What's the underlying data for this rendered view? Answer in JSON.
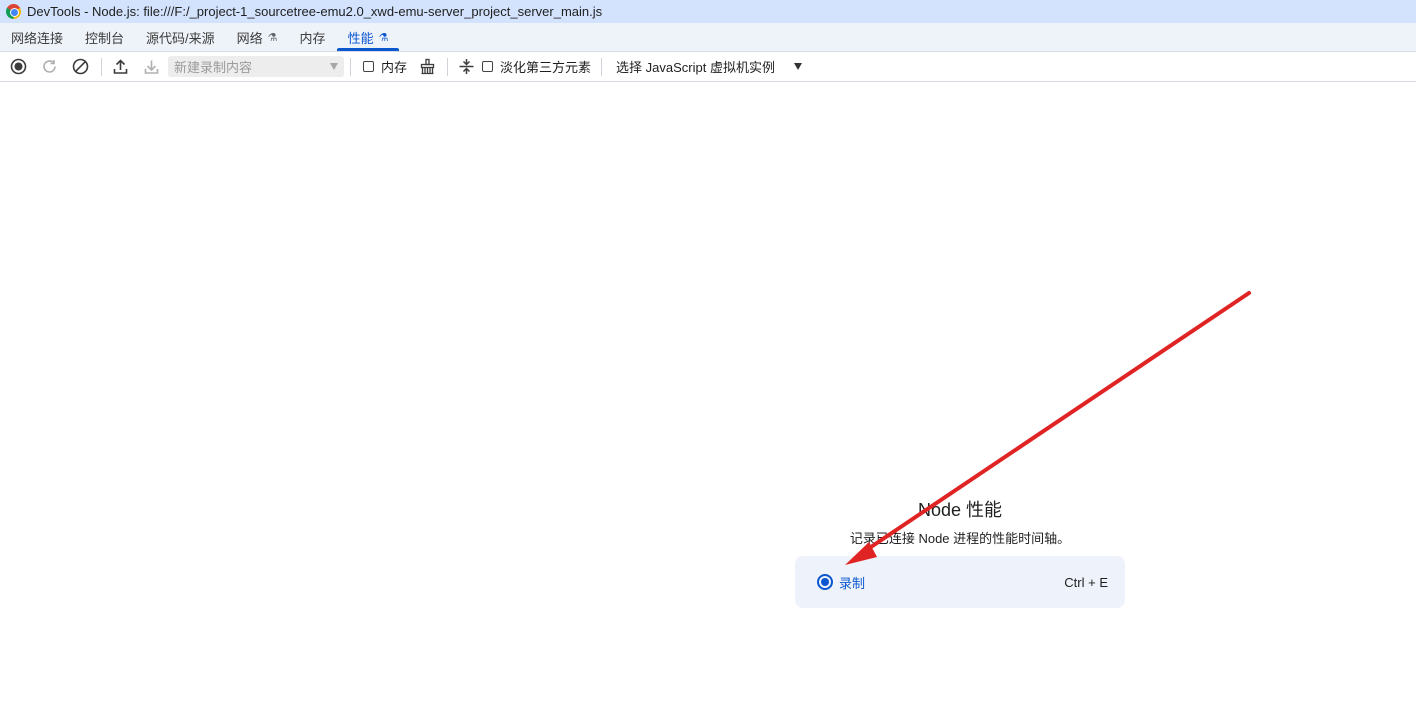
{
  "window": {
    "title": "DevTools - Node.js: file:///F:/_project-1_sourcetree-emu2.0_xwd-emu-server_project_server_main.js"
  },
  "tabs": [
    {
      "label": "网络连接",
      "experimental": false,
      "active": false
    },
    {
      "label": "控制台",
      "experimental": false,
      "active": false
    },
    {
      "label": "源代码/来源",
      "experimental": false,
      "active": false
    },
    {
      "label": "网络",
      "experimental": true,
      "active": false
    },
    {
      "label": "内存",
      "experimental": false,
      "active": false
    },
    {
      "label": "性能",
      "experimental": true,
      "active": true
    }
  ],
  "toolbar": {
    "recording_select_placeholder": "新建录制内容",
    "memory_checkbox_label": "内存",
    "dim_third_party_label": "淡化第三方元素",
    "vm_select_label": "选择 JavaScript 虚拟机实例"
  },
  "landing": {
    "heading": "Node 性能",
    "description": "记录已连接 Node 进程的性能时间轴。",
    "record_label": "录制",
    "record_shortcut": "Ctrl + E"
  },
  "colors": {
    "accent": "#0b57d0",
    "titlebar": "#d3e3fd",
    "annotation_arrow": "#e02424"
  },
  "icons": {
    "flask": "flask-icon",
    "record": "record-icon",
    "reload": "reload-record-icon",
    "clear": "clear-icon",
    "upload": "upload-icon",
    "download": "download-icon",
    "gc": "garbage-collect-icon",
    "collapse": "collapse-icon"
  }
}
